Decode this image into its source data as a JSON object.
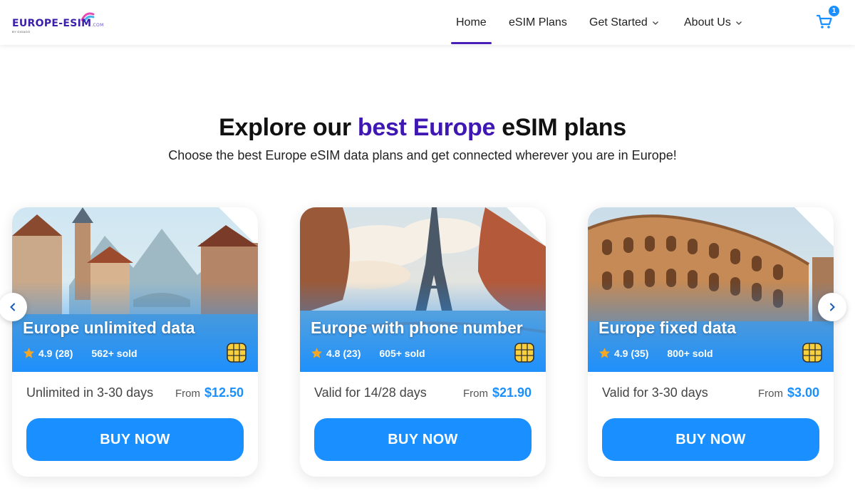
{
  "header": {
    "logo_text": "EUROPE-ESIM",
    "logo_domain": ".COM",
    "logo_sub": "BY GIGAGO",
    "nav": [
      {
        "label": "Home",
        "active": true
      },
      {
        "label": "eSIM Plans",
        "active": false
      },
      {
        "label": "Get Started",
        "active": false,
        "dropdown": true
      },
      {
        "label": "About Us",
        "active": false,
        "dropdown": true
      }
    ],
    "cart_icon": "cart-icon",
    "cart_count": "1"
  },
  "hero": {
    "title_pre": "Explore our ",
    "title_accent": "best Europe",
    "title_post": " eSIM plans",
    "subtitle": "Choose the best Europe eSIM data plans and get connected wherever you are in Europe!"
  },
  "cards": [
    {
      "title": "Europe unlimited data",
      "rating": "4.9",
      "rating_count": "(28)",
      "sold": "562+ sold",
      "validity": "Unlimited in 3-30 days",
      "from_label": "From",
      "price": "$12.50",
      "button": "BUY NOW"
    },
    {
      "title": "Europe with phone number",
      "rating": "4.8",
      "rating_count": "(23)",
      "sold": "605+ sold",
      "validity": "Valid for 14/28 days",
      "from_label": "From",
      "price": "$21.90",
      "button": "BUY NOW"
    },
    {
      "title": "Europe fixed data",
      "rating": "4.9",
      "rating_count": "(35)",
      "sold": "800+ sold",
      "validity": "Valid for 3-30 days",
      "from_label": "From",
      "price": "$3.00",
      "button": "BUY NOW"
    }
  ],
  "colors": {
    "brand_purple": "#3f17b3",
    "accent_blue": "#1a8fff",
    "star": "#f5a623"
  }
}
